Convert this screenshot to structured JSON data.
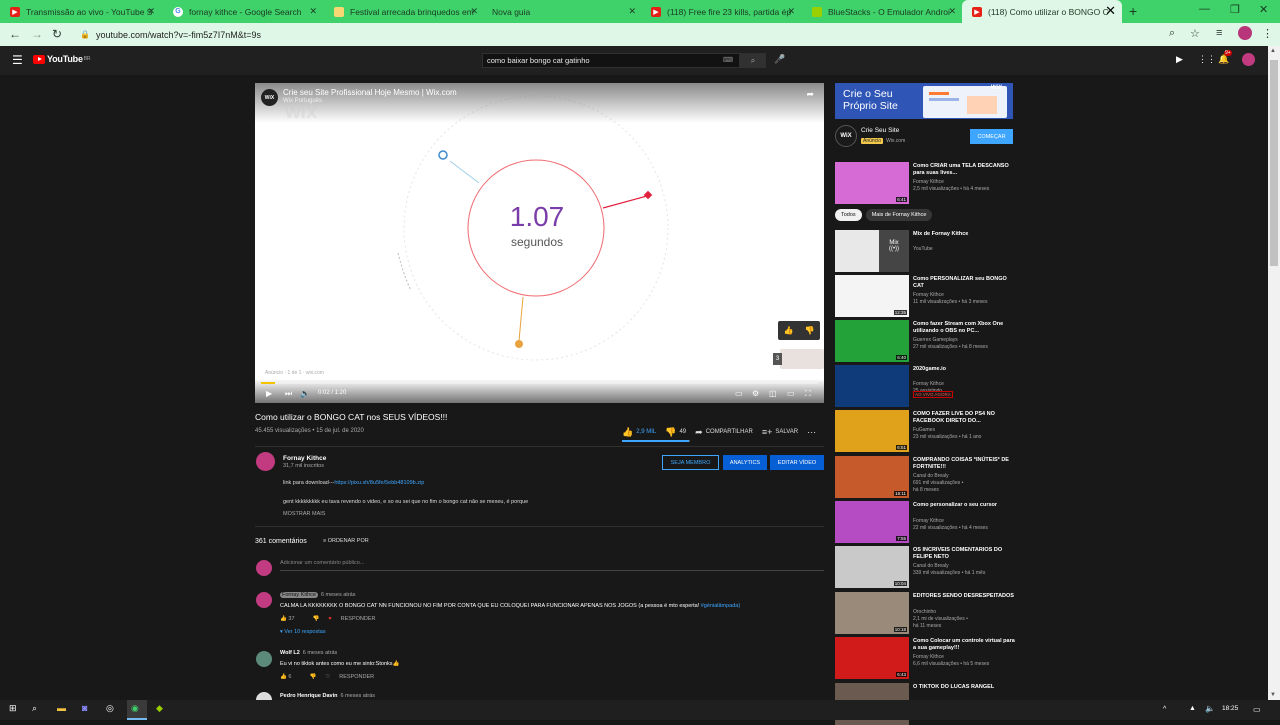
{
  "browser": {
    "tabs": [
      {
        "label": "Transmissão ao vivo - YouTube S",
        "favicon": "youtube-icon"
      },
      {
        "label": "fornay kithce - Google Search",
        "favicon": "google-icon"
      },
      {
        "label": "Festival arrecada brinquedos em",
        "favicon": "document-icon"
      },
      {
        "label": "Nova guia",
        "favicon": "none"
      },
      {
        "label": "(118) Free fire 23 kills, partida ép",
        "favicon": "youtube-icon"
      },
      {
        "label": "BlueStacks - O Emulador Androi",
        "favicon": "bluestacks-icon"
      },
      {
        "label": "(118) Como utilizar o BONGO C",
        "favicon": "youtube-icon",
        "active": true
      }
    ],
    "url": "youtube.com/watch?v=-fim5z7I7nM&t=9s"
  },
  "youtube": {
    "logo_text": "YouTube",
    "logo_region": "BR",
    "search_value": "como baixar bongo cat gatinho",
    "notification_count": "9+"
  },
  "video": {
    "overlay_title": "Crie seu Site Profissional Hoje Mesmo | Wix.com",
    "overlay_channel": "Wix Português",
    "watermark": "wix",
    "channel_logo": "WiX",
    "big_number": "1.07",
    "big_unit": "segundos",
    "ad_label": "Anúncio · 1 de 1 · wix.com",
    "skip_count": "3",
    "time": "0:02 / 1:20",
    "progress": 0.025
  },
  "info": {
    "title": "Como utilizar o BONGO CAT nos SEUS VÍDEOS!!!",
    "views": "45.455 visualizações • 15 de jul. de 2020",
    "likes": "2,9 MIL",
    "dislikes": "49",
    "share": "COMPARTILHAR",
    "save": "SALVAR",
    "like_ratio": 0.98
  },
  "channel": {
    "name": "Fornay Kithce",
    "subs": "31,7 mil inscritos",
    "btn_member": "SEJA MEMBRO",
    "btn_analytics": "ANALYTICS",
    "btn_edit": "EDITAR VÍDEO"
  },
  "description": {
    "line1_prefix": "link para download---",
    "line1_link": "https://pixu.sh/8u5fe/5ebb48109b.zip",
    "line2": "gent kkkkkkkkk eu tava revendo o video, e so eu sei que no fim o bongo cat não se mexeu, é porque",
    "more": "MOSTRAR MAIS"
  },
  "comments": {
    "count": "361 comentários",
    "sort": "ORDENAR POR",
    "add_placeholder": "Adicionar um comentário público...",
    "items": [
      {
        "author": "Fornay Kithce",
        "ago": "6 meses atrás",
        "text": "CALMA LA KKKKKKKK O BONGO CAT NN FUNCIONOU NO FIM POR CONTA QUE EU COLOQUEI PARA FUNCIONAR APENAS NOS JOGOS (a pessoa é mto esperta! ",
        "tag": "#génialâmpada)",
        "likes": "37",
        "reply": "RESPONDER",
        "replies": "Ver 10 respostas"
      },
      {
        "author": "Wolf L2",
        "ago": "6 meses atrás",
        "text": "Eu vi no tiktok antes como eu me sinto:Stonks👍",
        "likes": "6",
        "reply": "RESPONDER"
      },
      {
        "author": "Pedro Henrique Davin",
        "ago": "6 meses atrás"
      }
    ]
  },
  "sidebar": {
    "ad_headline_1": "Crie o Seu",
    "ad_headline_2": "Próprio Site",
    "ad_logo": "WiX",
    "ad_title": "Crie Seu Site",
    "ad_badge": "Anúncio",
    "ad_domain": "Wix.com",
    "ad_cta": "COMEÇAR",
    "chips": [
      "Todos",
      "Mais de Fornay Kithce"
    ],
    "recs": [
      {
        "title": "Como CRIAR uma TELA DESCANSO para suas lives...",
        "channel": "Fornay Kithce",
        "meta": "2,5 mil visualizações • há 4 meses",
        "dur": "6:41",
        "color": "#d66bd6"
      },
      {
        "title": "Mix de Fornay Kithce",
        "channel": "YouTube",
        "meta": "",
        "dur": "",
        "mix": "Mix",
        "color": "#e8e8e8"
      },
      {
        "title": "Como PERSONALIZAR seu BONGO CAT",
        "channel": "Fornay Kithce",
        "meta": "11 mil visualizações • há 3 meses",
        "dur": "12:35",
        "color": "#f4f4f4"
      },
      {
        "title": "Como fazer Stream com Xbox One utilizando o OBS no PC...",
        "channel": "Guerrex Gameplays",
        "meta": "27 mil visualizações • há 8 meses",
        "dur": "6:40",
        "color": "#23a23a"
      },
      {
        "title": "2020game.io",
        "channel": "Fornay Kithce",
        "meta": "25 assistindo",
        "dur": "",
        "live": "AO VIVO AGORA",
        "color": "#0f3b7a"
      },
      {
        "title": "COMO FAZER LIVE DO PS4 NO FACEBOOK DIRETO DO...",
        "channel": "FuGames",
        "meta": "23 mil visualizações • há 1 ano",
        "dur": "6:51",
        "color": "#e0a11b"
      },
      {
        "title": "COMPRANDO COISAS *INÚTEIS* DE FORTNITE!!!",
        "channel": "Canal do Brealy",
        "meta": "691 mil visualizações •",
        "meta2": "há 8 meses",
        "dur": "16:11",
        "color": "#c75a2a"
      },
      {
        "title": "Como personalizar o seu cursor",
        "channel": "Fornay Kithce",
        "meta": "22 mil visualizações • há 4 meses",
        "dur": "7:55",
        "color": "#b64cc4"
      },
      {
        "title": "OS INCRIVEIS COMENTARIOS DO FELIPE NETO",
        "channel": "Canal do Brealy",
        "meta": "339 mil visualizações • há 1 mês",
        "dur": "10:04",
        "color": "#c9c9c9"
      },
      {
        "title": "EDITORES SENDO DESRESPEITADOS",
        "channel": "Orochinho",
        "meta": "2,1 mi de visualizações •",
        "meta2": "há 11 meses",
        "dur": "10:18",
        "color": "#9a8a7a"
      },
      {
        "title": "Como Colocar um controle virtual para a sua gameplay!!!",
        "channel": "Fornay Kithce",
        "meta": "6,6 mil visualizações • há 5 meses",
        "dur": "6:43",
        "color": "#d11a1a"
      },
      {
        "title": "O TIKTOK DO LUCAS RANGEL",
        "channel": "",
        "meta": "",
        "dur": "",
        "color": "#6a5a50"
      }
    ]
  },
  "taskbar": {
    "time": "18:25"
  }
}
